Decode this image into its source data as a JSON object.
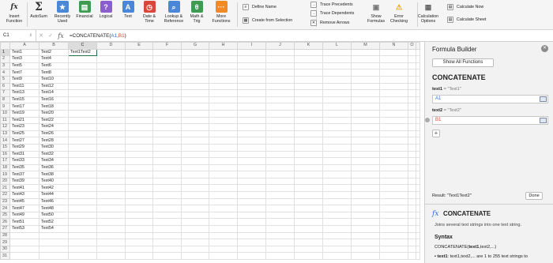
{
  "ribbon": {
    "buttons": [
      {
        "name": "insert-function-button",
        "label": "Insert Function",
        "glyph": "fx",
        "color": "none"
      },
      {
        "name": "autosum-button",
        "label": "AutoSum",
        "glyph": "Σ",
        "color": "none"
      },
      {
        "name": "recently-used-button",
        "label": "Recently Used",
        "glyph": "★",
        "color": "#4b87d9"
      },
      {
        "name": "financial-button",
        "label": "Financial",
        "glyph": "▤",
        "color": "#3f9a52"
      },
      {
        "name": "logical-button",
        "label": "Logical",
        "glyph": "?",
        "color": "#8b5ecf"
      },
      {
        "name": "text-button",
        "label": "Text",
        "glyph": "A",
        "color": "#4b87d9"
      },
      {
        "name": "date-time-button",
        "label": "Date & Time",
        "glyph": "◷",
        "color": "#d9473b"
      },
      {
        "name": "lookup-reference-button",
        "label": "Lookup & Reference",
        "glyph": "⌕",
        "color": "#4b87d9"
      },
      {
        "name": "math-trig-button",
        "label": "Math & Trig",
        "glyph": "θ",
        "color": "#3f9a52"
      },
      {
        "name": "more-functions-button",
        "label": "More Functions",
        "glyph": "···",
        "color": "#f08a24"
      }
    ],
    "define_name": "Define Name",
    "create_from_selection": "Create from Selection",
    "trace_precedents": "Trace Precedents",
    "trace_dependents": "Trace Dependents",
    "remove_arrows": "Remove Arrows",
    "show_formulas": "Show Formulas",
    "error_checking": "Error Checking",
    "calculation_options": "Calculation Options",
    "calculate_now": "Calculate Now",
    "calculate_sheet": "Calculate Sheet"
  },
  "formula_bar": {
    "name_box": "C1",
    "formula_prefix": "=CONCATENATE(",
    "ref1": "A1",
    "comma": ",",
    "ref2": "B1",
    "formula_suffix": ")"
  },
  "grid": {
    "columns": [
      "A",
      "B",
      "C",
      "D",
      "E",
      "F",
      "G",
      "H",
      "I",
      "J",
      "K",
      "L",
      "M",
      "N",
      "O"
    ],
    "col_a": [
      "Text1",
      "Text3",
      "Text5",
      "Text7",
      "Text9",
      "Text11",
      "Text13",
      "Text15",
      "Text17",
      "Text19",
      "Text21",
      "Text23",
      "Text25",
      "Text27",
      "Text29",
      "Text31",
      "Text33",
      "Text35",
      "Text37",
      "Text39",
      "Text41",
      "Text43",
      "Text45",
      "Text47",
      "Text49",
      "Text51",
      "Text53"
    ],
    "col_b": [
      "Text2",
      "Text4",
      "Text6",
      "Text8",
      "Text10",
      "Text12",
      "Text14",
      "Text16",
      "Text18",
      "Text20",
      "Text22",
      "Text24",
      "Text26",
      "Text28",
      "Text30",
      "Text32",
      "Text34",
      "Text36",
      "Text38",
      "Text40",
      "Text42",
      "Text44",
      "Text46",
      "Text48",
      "Text50",
      "Text52",
      "Text54"
    ],
    "c1": "Text1Text2",
    "row_count": 31
  },
  "panel": {
    "title": "Formula Builder",
    "show_all": "Show All Functions",
    "function_name": "CONCATENATE",
    "arg1_label": "text1",
    "arg1_value": "\"Text1\"",
    "arg1_field": "A1",
    "arg2_label": "text2",
    "arg2_value": "\"Text2\"",
    "arg2_field": "B1",
    "equals": "=",
    "result": "Result: \"Text1Text2\"",
    "done": "Done",
    "help_name": "CONCATENATE",
    "help_desc": "Joins several text strings into one text string.",
    "syntax_heading": "Syntax",
    "syntax_prefix": "CONCATENATE(",
    "syntax_bold": "text1",
    "syntax_suffix": ",text2,...)",
    "arg_desc_bold": "text1",
    "arg_desc": ": text1,text2,... are 1 to 255 text strings to"
  }
}
